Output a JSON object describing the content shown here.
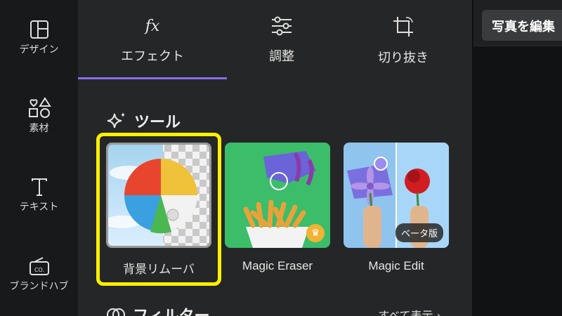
{
  "rail": {
    "items": [
      {
        "label": "デザイン",
        "icon": "layout-icon"
      },
      {
        "label": "素材",
        "icon": "elements-icon"
      },
      {
        "label": "テキスト",
        "icon": "text-icon"
      },
      {
        "label": "ブランドハブ",
        "icon": "brand-hub-icon"
      }
    ]
  },
  "tabs": [
    {
      "label": "エフェクト",
      "icon": "fx-icon",
      "active": true
    },
    {
      "label": "調整",
      "icon": "sliders-icon"
    },
    {
      "label": "切り抜き",
      "icon": "crop-icon"
    }
  ],
  "tools_section": {
    "title": "ツール",
    "icon": "sparkle-icon"
  },
  "tools": [
    {
      "name": "背景リムーバ",
      "selected": true
    },
    {
      "name": "Magic Eraser",
      "badge": "crown"
    },
    {
      "name": "Magic Edit",
      "badge_label": "ベータ版"
    }
  ],
  "filters_section": {
    "title": "フィルター",
    "show_all": "すべて表示 ›"
  },
  "header": {
    "edit_photo_label": "写真を編集"
  },
  "colors": {
    "accent": "#8b6cf4",
    "highlight": "#ffef00"
  }
}
